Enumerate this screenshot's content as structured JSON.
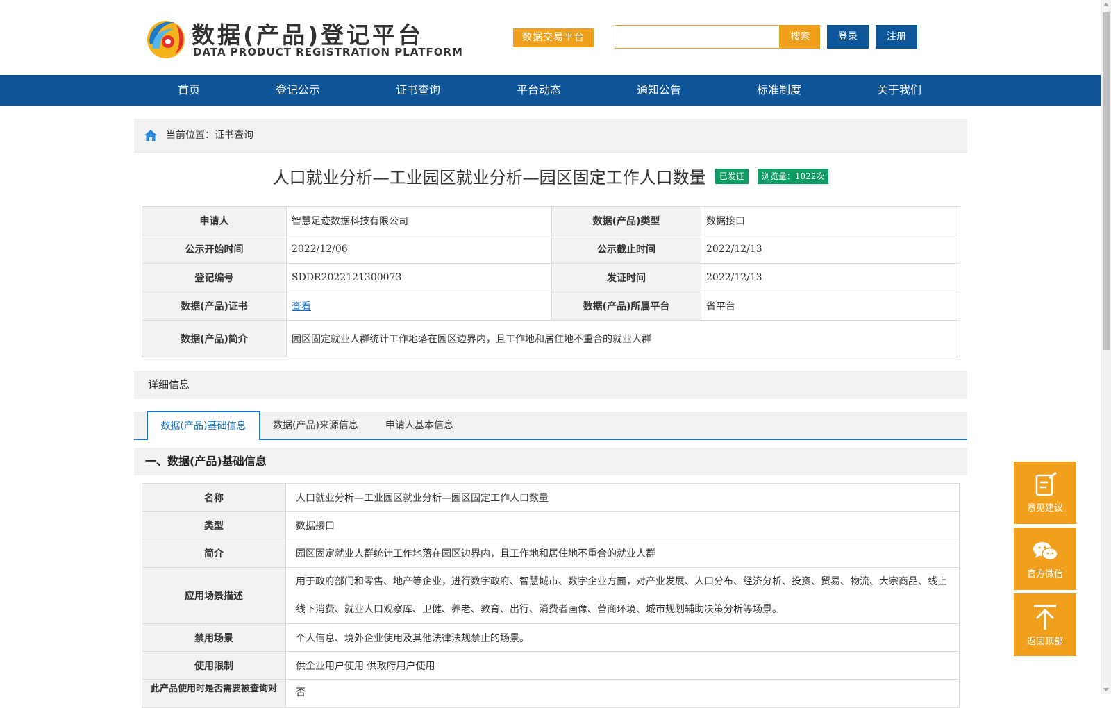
{
  "header": {
    "logo_cn": "数据(产品)登记平台",
    "logo_en": "DATA PRODUCT REGISTRATION PLATFORM",
    "trade_platform": "数据交易平台",
    "search_placeholder": "",
    "search_label": "搜索",
    "login_label": "登录",
    "register_label": "注册",
    "accent_color": "#f0a01c",
    "primary_color": "#0d5498"
  },
  "nav": {
    "items": [
      "首页",
      "登记公示",
      "证书查询",
      "平台动态",
      "通知公告",
      "标准制度",
      "关于我们"
    ]
  },
  "breadcrumb": "当前位置：证书查询",
  "product": {
    "title": "人口就业分析—工业园区就业分析—园区固定工作人口数量",
    "status_badge": "已发证",
    "views_badge": "浏览量：1022次",
    "badge_color": "#0e9b64"
  },
  "info_table": {
    "applicant_label": "申请人",
    "applicant_value": "智慧足迹数据科技有限公司",
    "type_label": "数据(产品)类型",
    "type_value": "数据接口",
    "pub_start_label": "公示开始时间",
    "pub_start_value": "2022/12/06",
    "pub_end_label": "公示截止时间",
    "pub_end_value": "2022/12/13",
    "reg_no_label": "登记编号",
    "reg_no_value": "SDDR2022121300073",
    "issue_label": "发证时间",
    "issue_value": "2022/12/13",
    "cert_label": "数据(产品)证书",
    "cert_value": "查看",
    "platform_label": "数据(产品)所属平台",
    "platform_value": "省平台",
    "intro_label": "数据(产品)简介",
    "intro_value": "园区固定就业人群统计工作地落在园区边界内，且工作地和居住地不重合的就业人群"
  },
  "detail_header": "详细信息",
  "tabs": [
    "数据(产品)基础信息",
    "数据(产品)来源信息",
    "申请人基本信息"
  ],
  "section_title": "一、数据(产品)基础信息",
  "detail_rows": [
    {
      "label": "名称",
      "value": "人口就业分析—工业园区就业分析—园区固定工作人口数量"
    },
    {
      "label": "类型",
      "value": "数据接口"
    },
    {
      "label": "简介",
      "value": "园区固定就业人群统计工作地落在园区边界内，且工作地和居住地不重合的就业人群"
    },
    {
      "label": "应用场景描述",
      "value": "用于政府部门和零售、地产等企业，进行数字政府、智慧城市、数字企业方面，对产业发展、人口分布、经济分析、投资、贸易、物流、大宗商品、线上线下消费、就业人口观察库、卫健、养老、教育、出行、消费者画像、营商环境、城市规划辅助决策分析等场景。"
    },
    {
      "label": "禁用场景",
      "value": "个人信息、境外企业使用及其他法律法规禁止的场景。"
    },
    {
      "label": "使用限制",
      "value": "供企业用户使用 供政府用户使用"
    },
    {
      "label": "此产品使用时是否需要被查询对",
      "value": "否"
    }
  ],
  "float_buttons": {
    "feedback": "意见建议",
    "wechat": "官方微信",
    "top": "返回顶部"
  }
}
